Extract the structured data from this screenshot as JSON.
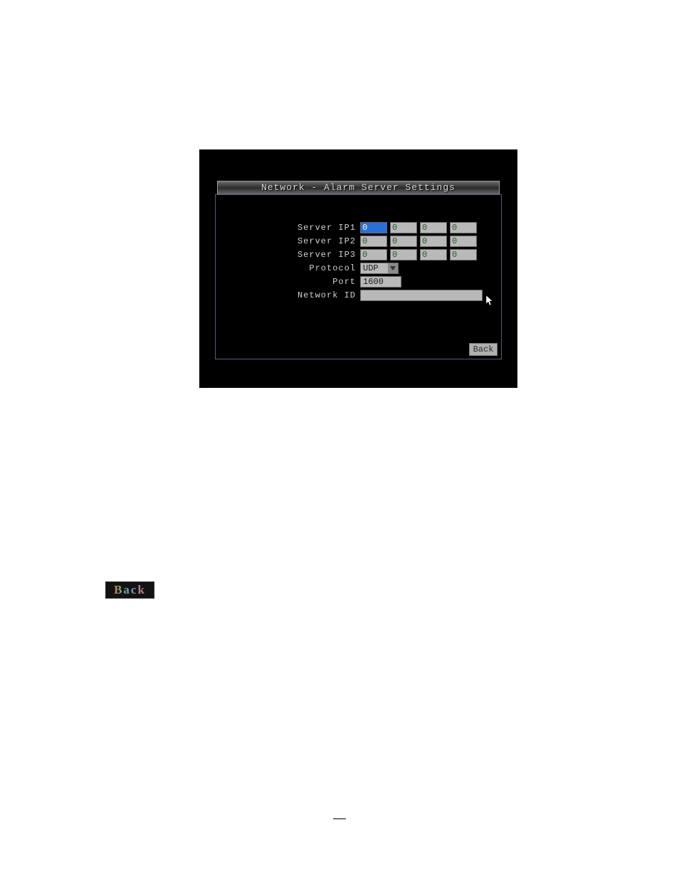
{
  "dialog": {
    "title": "Network - Alarm Server Settings",
    "fields": {
      "server_ip1": {
        "label": "Server IP1",
        "octets": [
          "0",
          "0",
          "0",
          "0"
        ],
        "focused_index": 0
      },
      "server_ip2": {
        "label": "Server IP2",
        "octets": [
          "0",
          "0",
          "0",
          "0"
        ]
      },
      "server_ip3": {
        "label": "Server IP3",
        "octets": [
          "0",
          "0",
          "0",
          "0"
        ]
      },
      "protocol": {
        "label": "Protocol",
        "value": "UDP"
      },
      "port": {
        "label": "Port",
        "value": "1600"
      },
      "network_id": {
        "label": "Network ID",
        "value": ""
      }
    },
    "buttons": {
      "back": "Back"
    }
  },
  "standalone_back_label": "Back"
}
